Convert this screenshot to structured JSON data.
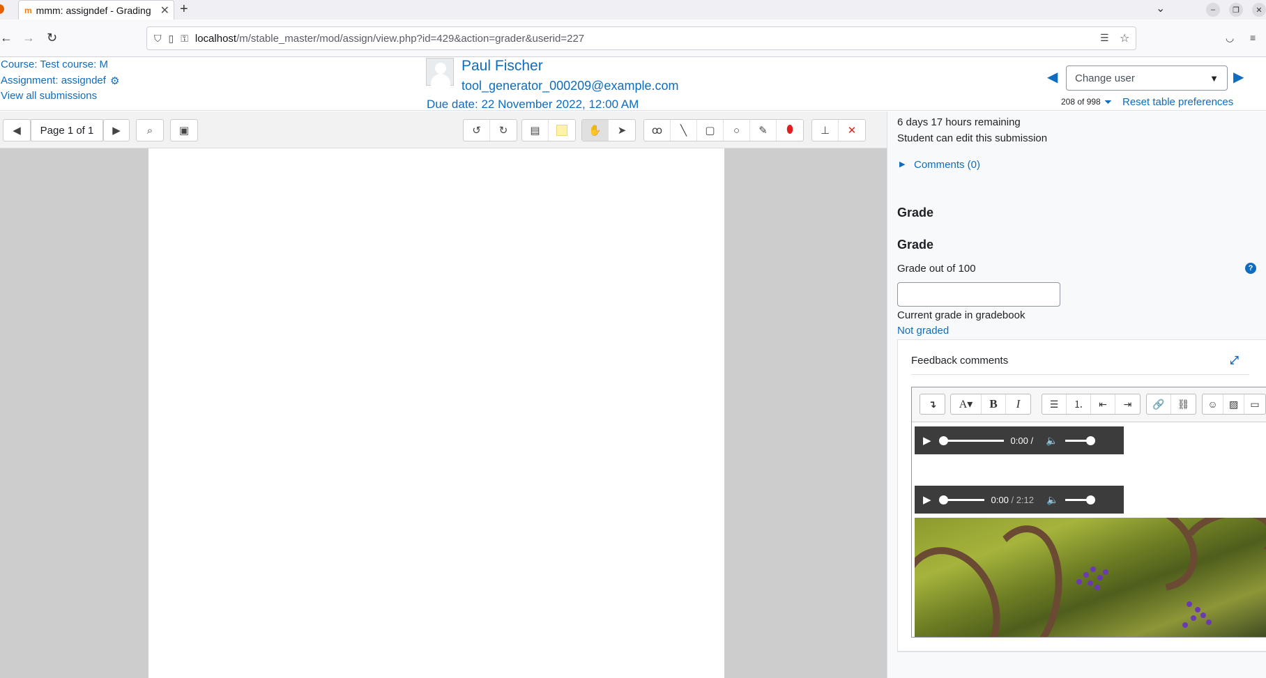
{
  "browser": {
    "tab_title": "mmm: assigndef - Grading",
    "url_host": "localhost",
    "url_path": "/m/stable_master/mod/assign/view.php?id=429&action=grader&userid=227"
  },
  "header": {
    "course_link": "Course: Test course: M",
    "assignment_link": "Assignment: assigndef",
    "view_all": "View all submissions",
    "user_name": "Paul Fischer",
    "user_email": "tool_generator_000209@example.com",
    "due_date": "Due date: 22 November 2022, 12:00 AM",
    "change_user_placeholder": "Change user",
    "count": "208 of 998",
    "reset": "Reset table preferences"
  },
  "pdf": {
    "page_label": "Page 1 of 1"
  },
  "panel": {
    "time_remaining": "6 days 17 hours remaining",
    "can_edit": "Student can edit this submission",
    "comments": "Comments (0)",
    "grade_section": "Grade",
    "grade_heading": "Grade",
    "grade_out_of": "Grade out of 100",
    "current_grade_label": "Current grade in gradebook",
    "current_grade_value": "Not graded",
    "feedback_title": "Feedback comments",
    "audio1_time": "0:00 /",
    "audio2_time": "0:00",
    "audio2_duration": "/ 2:12"
  },
  "colors": {
    "link": "#0f6cbf",
    "annotation_red": "#e02020"
  }
}
